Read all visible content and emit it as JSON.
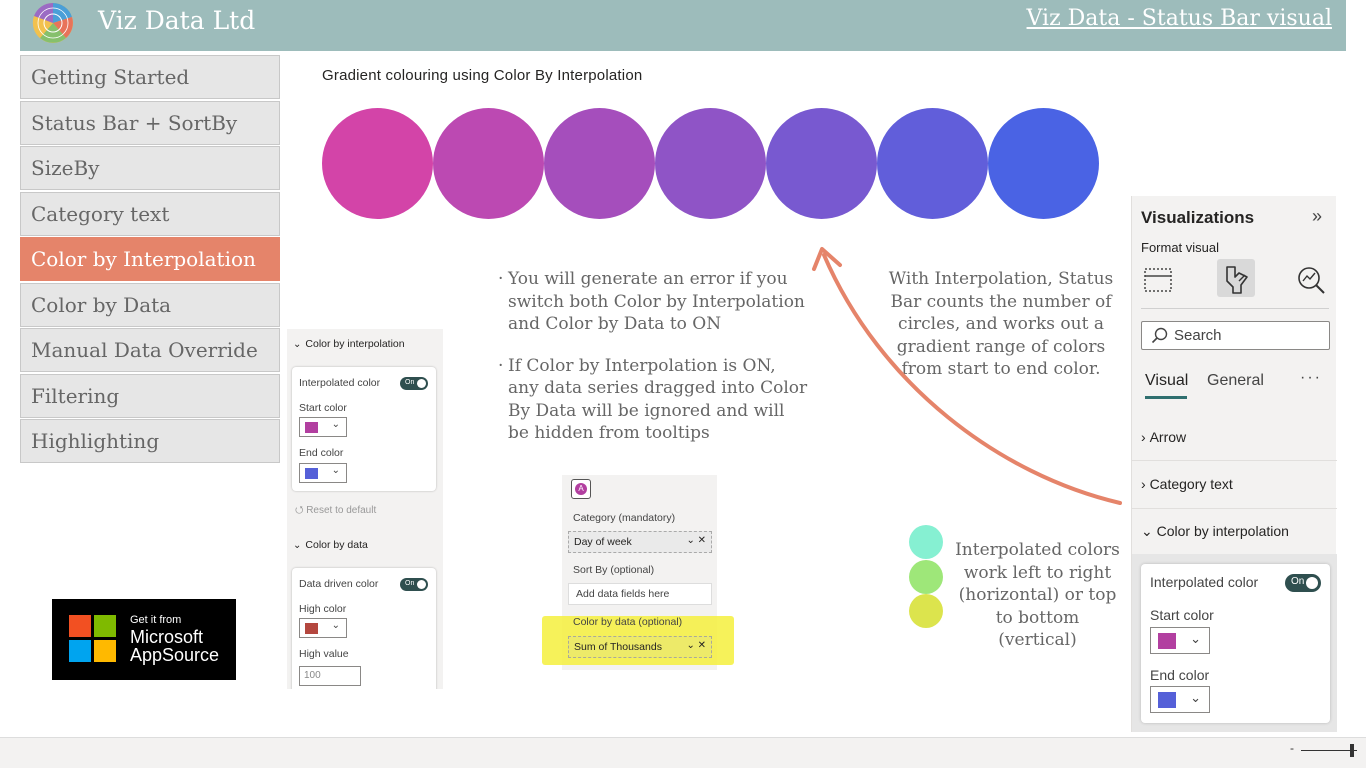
{
  "header": {
    "company": "Viz Data Ltd",
    "link": "Viz Data - Status Bar visual",
    "bg_color": "#9dbcbb"
  },
  "nav": {
    "items": [
      {
        "label": "Getting Started",
        "active": false
      },
      {
        "label": "Status Bar + SortBy",
        "active": false
      },
      {
        "label": "SizeBy",
        "active": false
      },
      {
        "label": "Category text",
        "active": false
      },
      {
        "label": "Color by Interpolation",
        "active": true
      },
      {
        "label": "Color by Data",
        "active": false
      },
      {
        "label": "Manual Data Override",
        "active": false
      },
      {
        "label": "Filtering",
        "active": false
      },
      {
        "label": "Highlighting",
        "active": false
      }
    ],
    "active_color": "#e5846a"
  },
  "badge": {
    "line1": "Get it from",
    "line2": "Microsoft",
    "line3": "AppSource"
  },
  "main": {
    "title": "Gradient colouring using Color By Interpolation",
    "gradient": {
      "start": "#d344a8",
      "end": "#4a63e4",
      "count": 7
    },
    "bullets": [
      "You will generate an error if you switch both Color by Interpolation and Color by Data to ON",
      "If Color by Interpolation is ON, any data series dragged into Color By Data will be ignored and will be hidden from tooltips"
    ],
    "interp_description": "With Interpolation, Status Bar counts the number of circles, and works out a gradient range of colors from start to end color.",
    "dots_description": "Interpolated colors work left to right (horizontal) or top to bottom (vertical)",
    "dot_colors": [
      "#86f0d2",
      "#9ee779",
      "#dce44d"
    ]
  },
  "format_panel": {
    "section1": "Color by interpolation",
    "interpolated_label": "Interpolated color",
    "toggle": "On",
    "start_label": "Start color",
    "start_color": "#b23fa0",
    "end_label": "End color",
    "end_color": "#5560d8",
    "reset": "Reset to default",
    "section2": "Color by data",
    "data_driven_label": "Data driven color",
    "high_label": "High color",
    "high_color": "#b4473f",
    "high_value_label": "High value",
    "high_value": "100"
  },
  "field_wells": {
    "icon": "A",
    "category_label": "Category (mandatory)",
    "category_field": "Day of week",
    "sortby_label": "Sort By (optional)",
    "sortby_placeholder": "Add data fields here",
    "colorby_label": "Color by data (optional)",
    "colorby_field": "Sum of Thousands"
  },
  "viz_pane": {
    "title": "Visualizations",
    "expand": "»",
    "format_label": "Format visual",
    "search": "Search",
    "tab_visual": "Visual",
    "tab_general": "General",
    "more": "···",
    "sec_arrow": "Arrow",
    "sec_category": "Category text",
    "sec_color": "Color by interpolation",
    "interpolated_label": "Interpolated color",
    "toggle": "On",
    "start_label": "Start color",
    "start_color": "#b23fa0",
    "end_label": "End color",
    "end_color": "#5560d8"
  },
  "bottombar": {
    "zoom_minus": "-"
  }
}
